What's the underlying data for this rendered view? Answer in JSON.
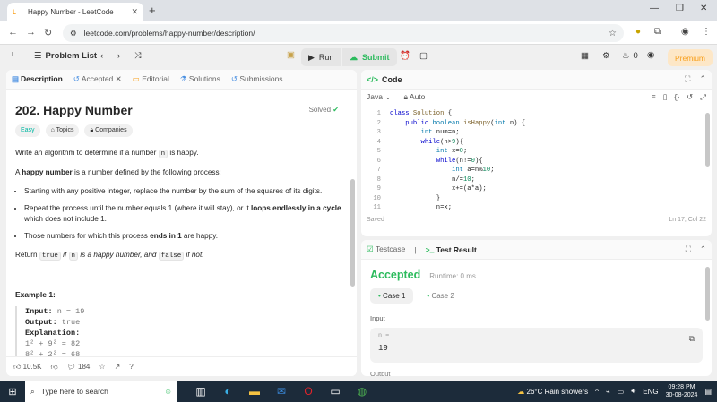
{
  "browser": {
    "tab_title": "Happy Number - LeetCode",
    "url": "leetcode.com/problems/happy-number/description/"
  },
  "lc_header": {
    "problem_list": "Problem List",
    "run": "Run",
    "submit": "Submit",
    "streak": "0",
    "premium": "Premium"
  },
  "left_tabs": [
    "Description",
    "Accepted",
    "Editorial",
    "Solutions",
    "Submissions"
  ],
  "problem": {
    "title": "202. Happy Number",
    "solved": "Solved",
    "difficulty": "Easy",
    "topics": "Topics",
    "companies": "Companies",
    "p1_a": "Write an algorithm to determine if a number ",
    "p1_code": "n",
    "p1_b": " is happy.",
    "p2_a": "A ",
    "p2_bold": "happy number",
    "p2_b": " is a number defined by the following process:",
    "li1": "Starting with any positive integer, replace the number by the sum of the squares of its digits.",
    "li2_a": "Repeat the process until the number equals 1 (where it will stay), or it ",
    "li2_bold": "loops endlessly in a cycle",
    "li2_b": " which does not include 1.",
    "li3_a": "Those numbers for which this process ",
    "li3_bold": "ends in 1",
    "li3_b": " are happy.",
    "ret_a": "Return ",
    "ret_c1": "true",
    "ret_b": " if ",
    "ret_c2": "n",
    "ret_c": " is a happy number, and ",
    "ret_c3": "false",
    "ret_d": " if not.",
    "example_title": "Example 1:",
    "ex_input_label": "Input:",
    "ex_input_val": "n = 19",
    "ex_output_label": "Output:",
    "ex_output_val": "true",
    "ex_expl_label": "Explanation:",
    "ex_line1": "1² + 9² = 82",
    "ex_line2": "8² + 2² = 68"
  },
  "left_footer": {
    "likes": "10.5K",
    "comments": "184"
  },
  "code": {
    "header": "Code",
    "language": "Java",
    "mode": "Auto",
    "status": "Saved",
    "cursor": "Ln 17, Col 22",
    "lines": [
      {
        "n": "1",
        "text": "class Solution {"
      },
      {
        "n": "2",
        "text": "    public boolean isHappy(int n) {"
      },
      {
        "n": "3",
        "text": "        int num=n;"
      },
      {
        "n": "4",
        "text": "        while(n>9){"
      },
      {
        "n": "5",
        "text": "            int x=0;"
      },
      {
        "n": "6",
        "text": "            while(n!=0){"
      },
      {
        "n": "7",
        "text": "                int a=n%10;"
      },
      {
        "n": "8",
        "text": "                n/=10;"
      },
      {
        "n": "9",
        "text": "                x+=(a*a);"
      },
      {
        "n": "10",
        "text": "            }"
      },
      {
        "n": "11",
        "text": "            n=x;"
      }
    ]
  },
  "result": {
    "tab_testcase": "Testcase",
    "tab_result": "Test Result",
    "accepted": "Accepted",
    "runtime": "Runtime: 0 ms",
    "case1": "Case 1",
    "case2": "Case 2",
    "input_label": "Input",
    "n_label": "n =",
    "n_value": "19",
    "output_label": "Output"
  },
  "taskbar": {
    "search_placeholder": "Type here to search",
    "weather": "26°C  Rain showers",
    "lang": "ENG",
    "time": "09:28 PM",
    "date": "30-08-2024"
  }
}
